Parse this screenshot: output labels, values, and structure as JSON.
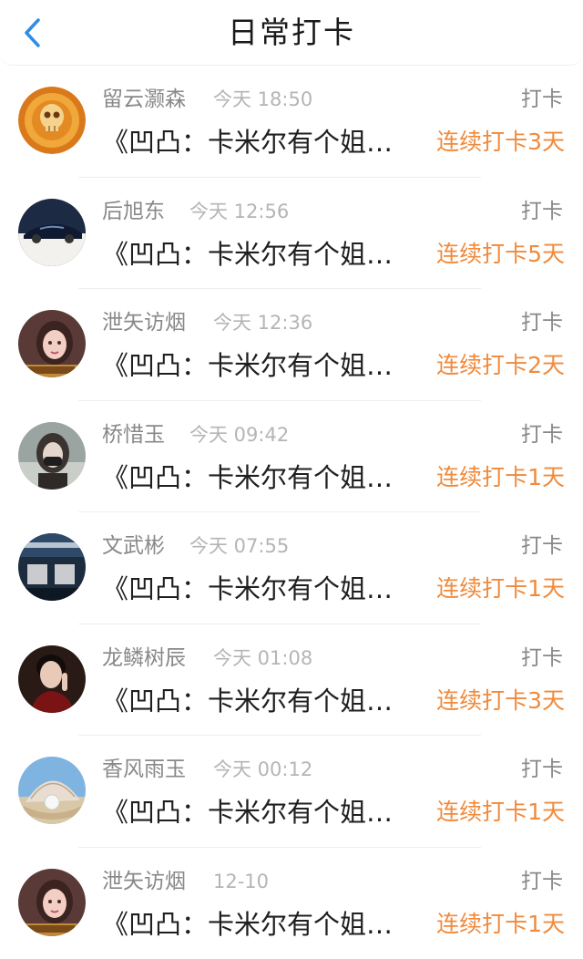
{
  "header": {
    "title": "日常打卡",
    "back_icon": "chevron-left-icon",
    "accent": "#2f8de4"
  },
  "colors": {
    "streak": "#f08a3c",
    "name": "#888888",
    "time": "#b5b5b5"
  },
  "items": [
    {
      "name": "留云灏森",
      "time": "今天 18:50",
      "action": "打卡",
      "title": "《凹凸：卡米尔有个姐…",
      "streak": "连续打卡3天",
      "avatar": "skull-avatar"
    },
    {
      "name": "后旭东",
      "time": "今天 12:56",
      "action": "打卡",
      "title": "《凹凸：卡米尔有个姐…",
      "streak": "连续打卡5天",
      "avatar": "car-avatar"
    },
    {
      "name": "泄矢访烟",
      "time": "今天 12:36",
      "action": "打卡",
      "title": "《凹凸：卡米尔有个姐…",
      "streak": "连续打卡2天",
      "avatar": "girl-avatar"
    },
    {
      "name": "桥惜玉",
      "time": "今天 09:42",
      "action": "打卡",
      "title": "《凹凸：卡米尔有个姐…",
      "streak": "连续打卡1天",
      "avatar": "masked-girl-avatar"
    },
    {
      "name": "文武彬",
      "time": "今天 07:55",
      "action": "打卡",
      "title": "《凹凸：卡米尔有个姐…",
      "streak": "连续打卡1天",
      "avatar": "text-avatar"
    },
    {
      "name": "龙鳞树辰",
      "time": "今天 01:08",
      "action": "打卡",
      "title": "《凹凸：卡米尔有个姐…",
      "streak": "连续打卡3天",
      "avatar": "man-avatar"
    },
    {
      "name": "香风雨玉",
      "time": "今天 00:12",
      "action": "打卡",
      "title": "《凹凸：卡米尔有个姐…",
      "streak": "连续打卡1天",
      "avatar": "pearl-avatar"
    },
    {
      "name": "泄矢访烟",
      "time": "12-10",
      "action": "打卡",
      "title": "《凹凸：卡米尔有个姐…",
      "streak": "连续打卡1天",
      "avatar": "girl-avatar"
    }
  ]
}
